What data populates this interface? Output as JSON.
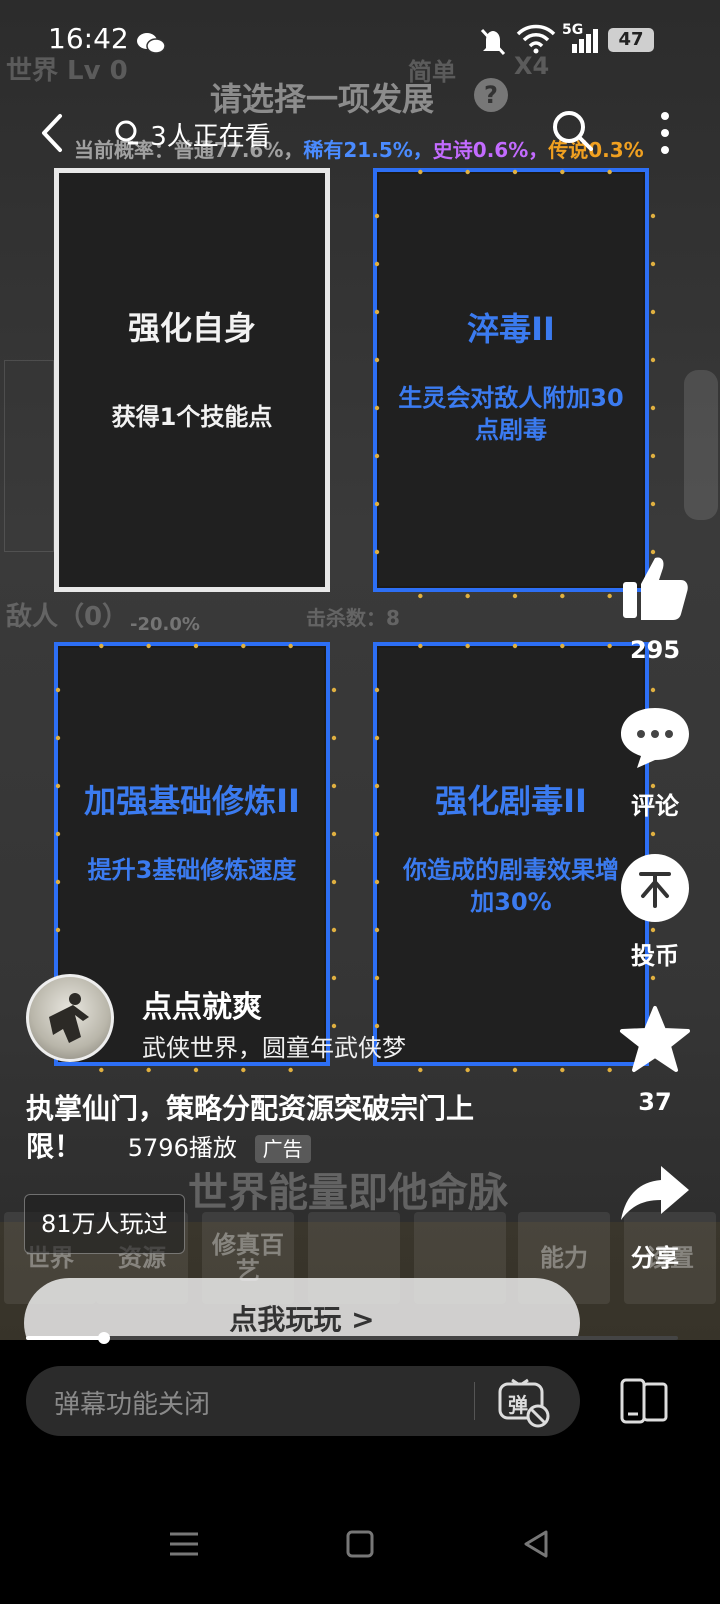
{
  "status_bar": {
    "time": "16:42",
    "network": "5G",
    "battery": "47"
  },
  "top_nav": {
    "watching": "3人正在看"
  },
  "game_bg": {
    "title": "请选择一项发展",
    "world_level": "世界 Lv 0",
    "difficulty": "简单",
    "speed": "X4",
    "rates": {
      "prefix": "当前概率：普通77.6%，",
      "rare": "稀有21.5%，",
      "epic": "史诗0.6%，",
      "legend": "传说0.3%"
    },
    "enemy": "敌人（0）",
    "enemy_pct": "-20.0%",
    "kills": "击杀数：8",
    "banner": "世界能量即他命脉",
    "tabs": [
      "世界",
      "资源",
      "修真百艺",
      "",
      "",
      "能力",
      "设置"
    ]
  },
  "cards": [
    {
      "title": "强化自身",
      "desc": "获得1个技能点"
    },
    {
      "title": "淬毒II",
      "desc": "生灵会对敌人附加30点剧毒"
    },
    {
      "title": "加强基础修炼II",
      "desc": "提升3基础修炼速度"
    },
    {
      "title": "强化剧毒II",
      "desc": "你造成的剧毒效果增加30%"
    }
  ],
  "right_rail": {
    "like_count": "295",
    "comment_label": "评论",
    "coin_label": "投币",
    "fav_count": "37",
    "share_label": "分享"
  },
  "author": {
    "name": "点点就爽",
    "subtitle": "武侠世界，圆童年武侠梦"
  },
  "video": {
    "title_line1": "执掌仙门，策略分配资源突破宗门上",
    "title_line2": "限！",
    "plays": "5796播放",
    "ad_tag": "广告",
    "played_count": "81万人玩过",
    "cta": "点我玩玩 >",
    "progress": 0.12
  },
  "danmaku": {
    "placeholder": "弹幕功能关闭",
    "toggle_glyph": "弹"
  },
  "colors": {
    "accent_blue": "#2d6ff5",
    "rare": "#4a8bff",
    "epic": "#c36bff",
    "legend": "#f0a020"
  }
}
